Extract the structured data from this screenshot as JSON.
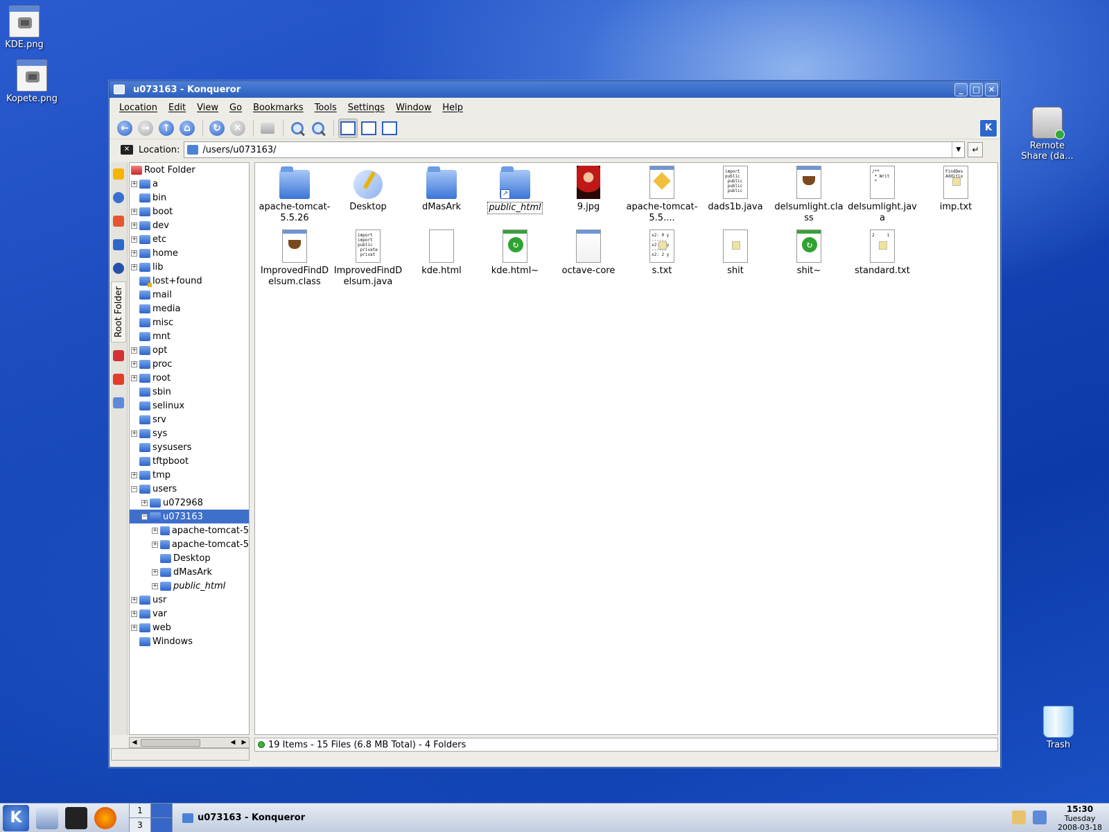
{
  "desktop": {
    "icons": [
      {
        "label": "KDE.png"
      },
      {
        "label": "Kopete.png"
      },
      {
        "label": "Remote Share (da..."
      },
      {
        "label": "Trash"
      }
    ]
  },
  "window": {
    "title": "u073163 - Konqueror",
    "buttons": {
      "minimize": "_",
      "maximize": "□",
      "close": "✕"
    }
  },
  "menubar": [
    "Location",
    "Edit",
    "View",
    "Go",
    "Bookmarks",
    "Tools",
    "Settings",
    "Window",
    "Help"
  ],
  "location": {
    "label": "Location:",
    "value": "/users/u073163/"
  },
  "sidebar": {
    "active_tab": "Root Folder"
  },
  "tree": {
    "root": "Root Folder",
    "items": [
      {
        "label": "a",
        "level": 1,
        "expander": "+"
      },
      {
        "label": "bin",
        "level": 1,
        "expander": ""
      },
      {
        "label": "boot",
        "level": 1,
        "expander": "+"
      },
      {
        "label": "dev",
        "level": 1,
        "expander": "+"
      },
      {
        "label": "etc",
        "level": 1,
        "expander": "+"
      },
      {
        "label": "home",
        "level": 1,
        "expander": "+"
      },
      {
        "label": "lib",
        "level": 1,
        "expander": "+"
      },
      {
        "label": "lost+found",
        "level": 1,
        "expander": ""
      },
      {
        "label": "mail",
        "level": 1,
        "expander": ""
      },
      {
        "label": "media",
        "level": 1,
        "expander": ""
      },
      {
        "label": "misc",
        "level": 1,
        "expander": ""
      },
      {
        "label": "mnt",
        "level": 1,
        "expander": ""
      },
      {
        "label": "opt",
        "level": 1,
        "expander": "+"
      },
      {
        "label": "proc",
        "level": 1,
        "expander": "+"
      },
      {
        "label": "root",
        "level": 1,
        "expander": "+"
      },
      {
        "label": "sbin",
        "level": 1,
        "expander": ""
      },
      {
        "label": "selinux",
        "level": 1,
        "expander": ""
      },
      {
        "label": "srv",
        "level": 1,
        "expander": ""
      },
      {
        "label": "sys",
        "level": 1,
        "expander": "+"
      },
      {
        "label": "sysusers",
        "level": 1,
        "expander": ""
      },
      {
        "label": "tftpboot",
        "level": 1,
        "expander": ""
      },
      {
        "label": "tmp",
        "level": 1,
        "expander": "+"
      },
      {
        "label": "users",
        "level": 1,
        "expander": "−"
      },
      {
        "label": "u072968",
        "level": 2,
        "expander": "+"
      },
      {
        "label": "u073163",
        "level": 2,
        "expander": "−",
        "selected": true
      },
      {
        "label": "apache-tomcat-5",
        "level": 3,
        "expander": "+"
      },
      {
        "label": "apache-tomcat-5",
        "level": 3,
        "expander": "+"
      },
      {
        "label": "Desktop",
        "level": 3,
        "expander": ""
      },
      {
        "label": "dMasArk",
        "level": 3,
        "expander": "+"
      },
      {
        "label": "public_html",
        "level": 3,
        "expander": "+",
        "italic": true
      },
      {
        "label": "usr",
        "level": 1,
        "expander": "+"
      },
      {
        "label": "var",
        "level": 1,
        "expander": "+"
      },
      {
        "label": "web",
        "level": 1,
        "expander": "+"
      },
      {
        "label": "Windows",
        "level": 1,
        "expander": ""
      }
    ]
  },
  "files": [
    {
      "label": "apache-tomcat-5.5.26",
      "icon": "folder-icon"
    },
    {
      "label": "Desktop",
      "icon": "desktop-icon"
    },
    {
      "label": "dMasArk",
      "icon": "folder-icon"
    },
    {
      "label": "public_html",
      "icon": "folder-link-icon",
      "focused": true
    },
    {
      "label": "9.jpg",
      "icon": "image-icon"
    },
    {
      "label": "apache-tomcat-5.5....",
      "icon": "package-icon"
    },
    {
      "label": "dads1b.java",
      "icon": "java-source-icon",
      "preview": "import\npublic\n public\n public\n public"
    },
    {
      "label": "delsumlight.class",
      "icon": "java-class-icon"
    },
    {
      "label": "delsumlight.java",
      "icon": "java-source-icon",
      "preview": "/**\n * Writ\n *"
    },
    {
      "label": "imp.txt",
      "icon": "text-icon",
      "preview": "FindDes\nAdditio"
    },
    {
      "label": "ImprovedFindDelsum.class",
      "icon": "java-class-icon"
    },
    {
      "label": "ImprovedFindDelsum.java",
      "icon": "java-source-icon",
      "preview": "import\nimport\npublic\n private\n privat"
    },
    {
      "label": "kde.html",
      "icon": "html-icon"
    },
    {
      "label": "kde.html~",
      "icon": "backup-icon"
    },
    {
      "label": "octave-core",
      "icon": "blank-icon"
    },
    {
      "label": "s.txt",
      "icon": "text-icon",
      "preview": "x2: 0 y\n------\nx2: 1 y\n------\nx2: 2 y"
    },
    {
      "label": "shit",
      "icon": "text-icon",
      "preview": ""
    },
    {
      "label": "shit~",
      "icon": "backup-icon"
    },
    {
      "label": "standard.txt",
      "icon": "text-icon",
      "preview": "2     1"
    }
  ],
  "status": {
    "text": "19 Items - 15 Files (6.8 MB Total) - 4 Folders"
  },
  "taskbar": {
    "pager": [
      "1",
      "",
      "3",
      ""
    ],
    "task_title": "u073163 - Konqueror",
    "clock": {
      "time": "15:30",
      "day": "Tuesday",
      "date": "2008-03-18"
    }
  }
}
